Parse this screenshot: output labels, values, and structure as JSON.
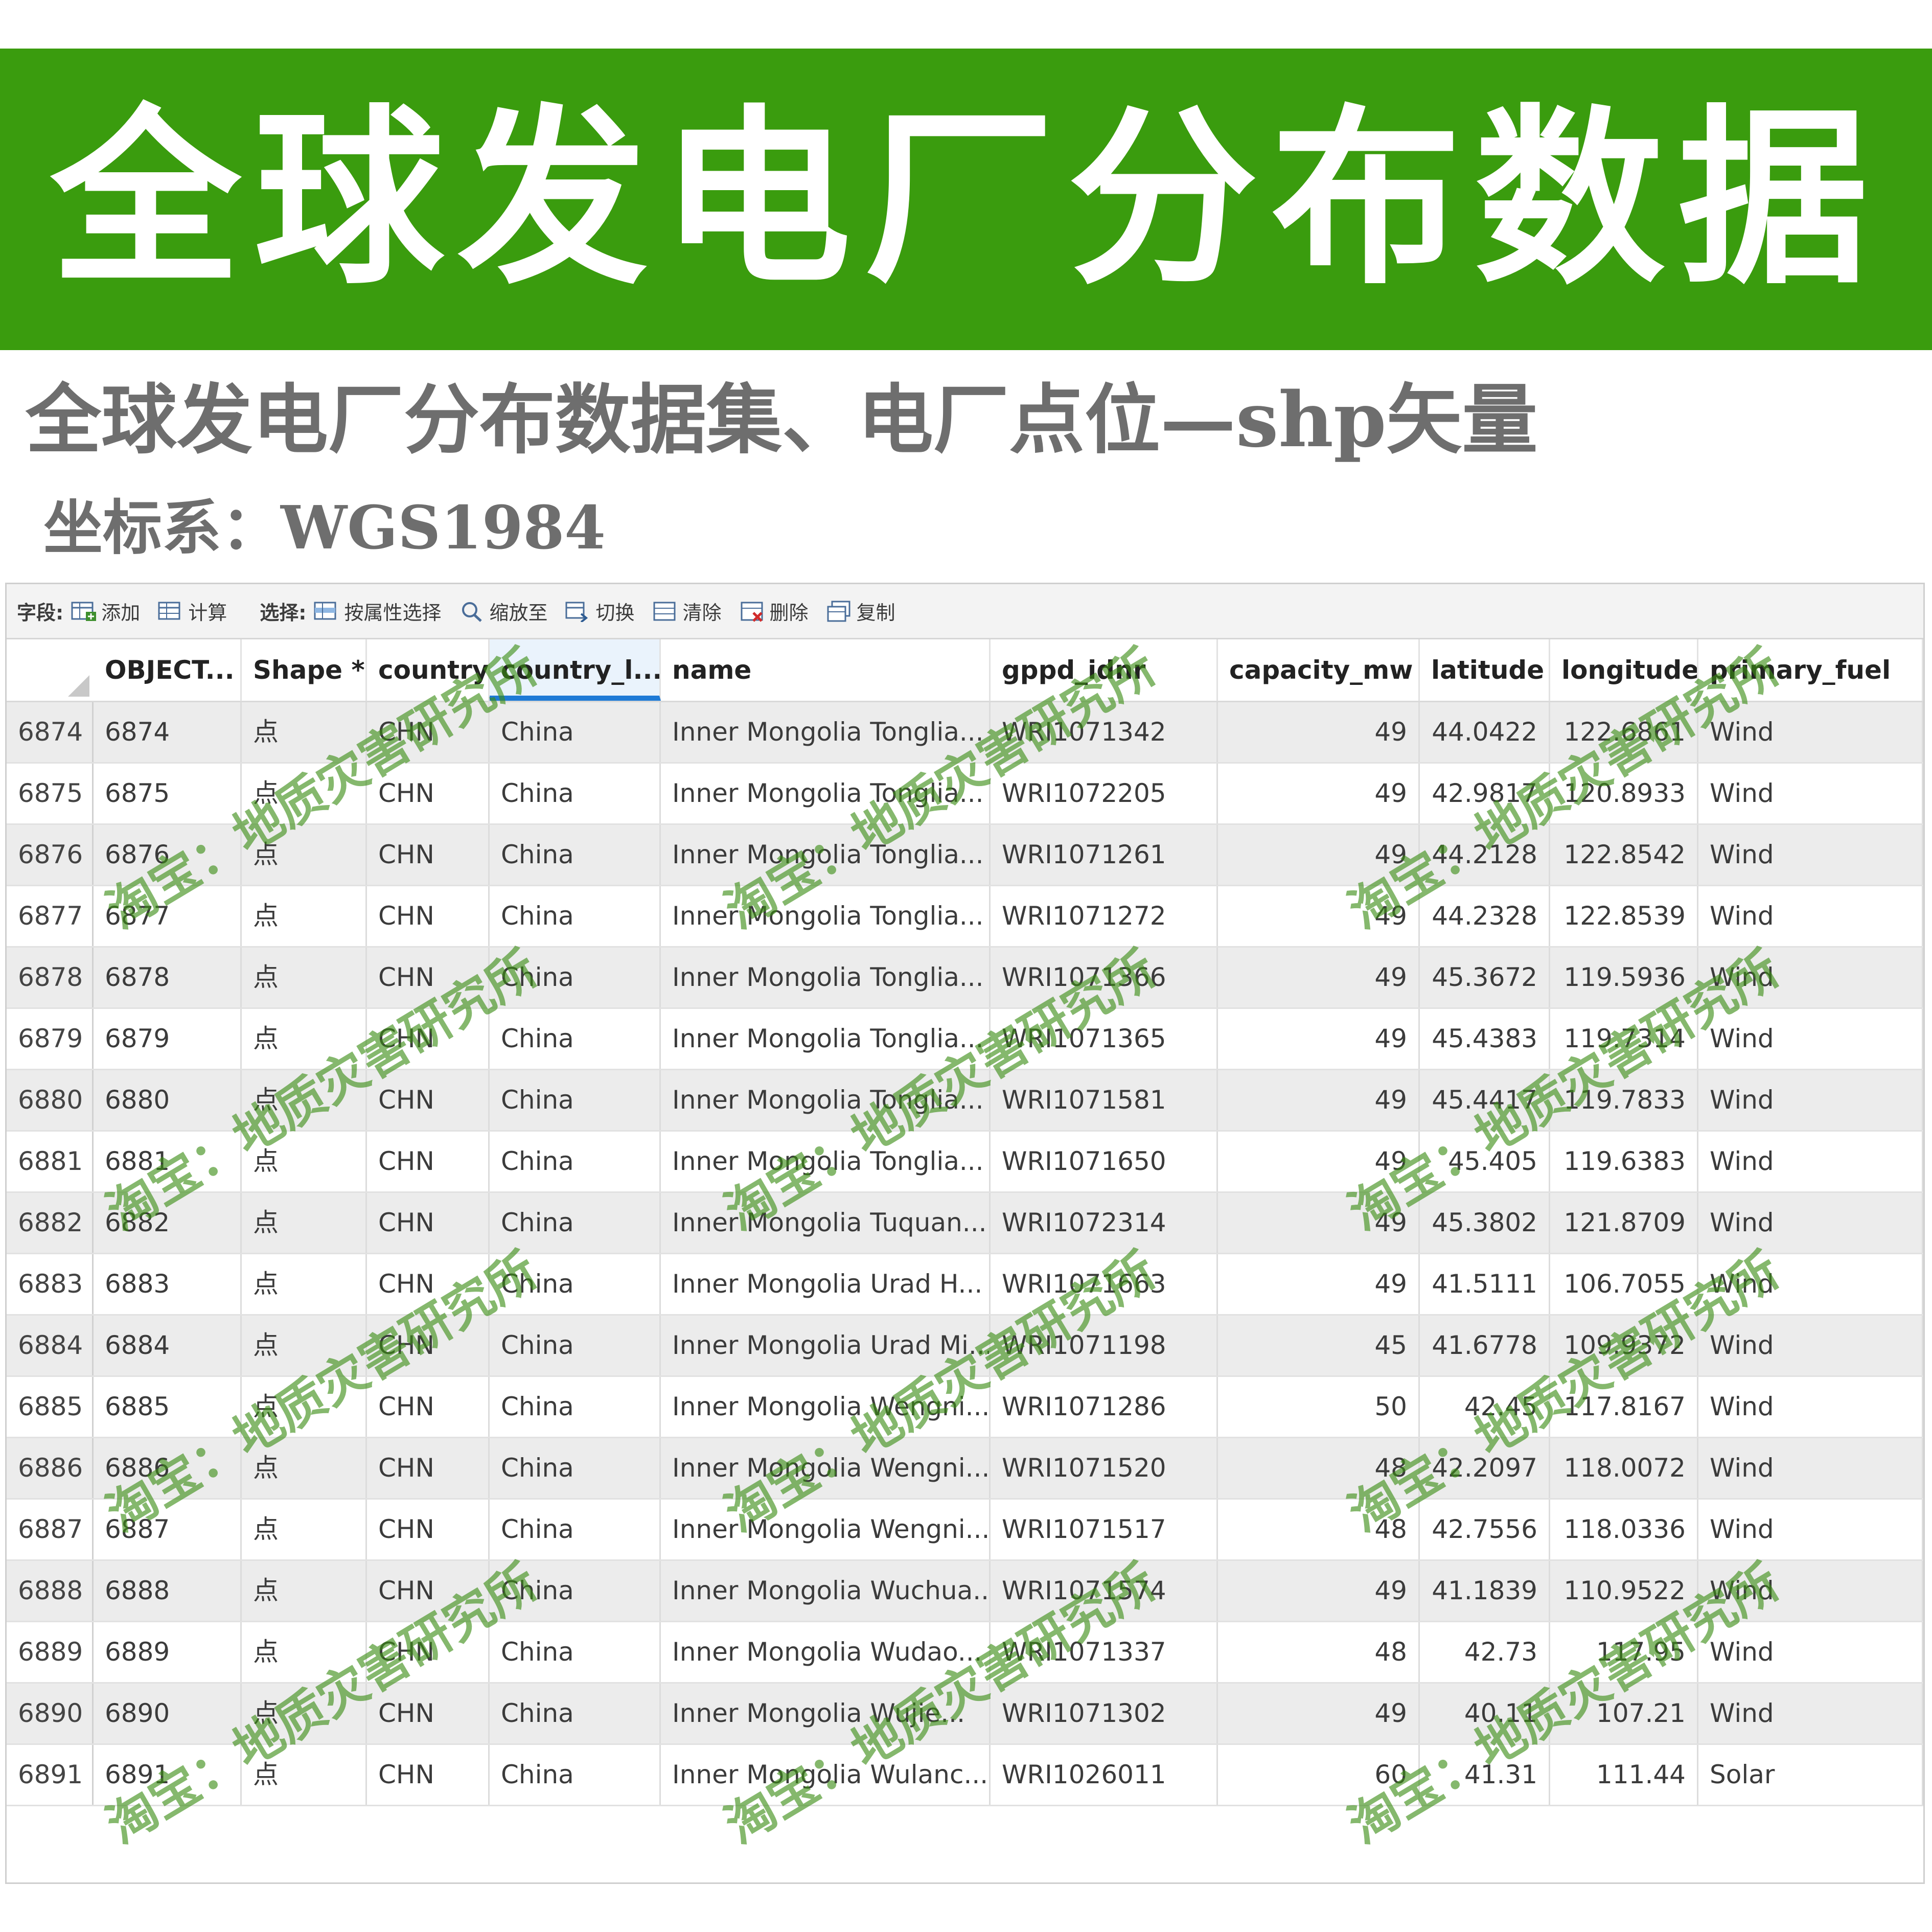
{
  "banner": {
    "title": "全球发电厂分布数据"
  },
  "subtitle": "全球发电厂分布数据集、电厂点位—shp矢量",
  "crs_line": "坐标系：WGS1984",
  "toolbar": {
    "field_label": "字段:",
    "add": "添加",
    "calculate": "计算",
    "select_label": "选择:",
    "select_by_attr": "按属性选择",
    "zoom_to": "缩放至",
    "switch": "切换",
    "clear": "清除",
    "delete": "删除",
    "copy": "复制"
  },
  "table": {
    "columns": [
      "OBJECT...",
      "Shape *",
      "country",
      "country_l...",
      "name",
      "gppd_idnr",
      "capacity_mw",
      "latitude",
      "longitude",
      "primary_fuel"
    ],
    "rows": [
      {
        "rowhdr": "6874",
        "objectid": "6874",
        "shape": "点",
        "country": "CHN",
        "country_long": "China",
        "name": "Inner Mongolia Tonglia...",
        "gppd_idnr": "WRI1071342",
        "capacity_mw": "49",
        "latitude": "44.0422",
        "longitude": "122.6861",
        "primary_fuel": "Wind"
      },
      {
        "rowhdr": "6875",
        "objectid": "6875",
        "shape": "点",
        "country": "CHN",
        "country_long": "China",
        "name": "Inner Mongolia Tonglia...",
        "gppd_idnr": "WRI1072205",
        "capacity_mw": "49",
        "latitude": "42.9817",
        "longitude": "120.8933",
        "primary_fuel": "Wind"
      },
      {
        "rowhdr": "6876",
        "objectid": "6876",
        "shape": "点",
        "country": "CHN",
        "country_long": "China",
        "name": "Inner Mongolia Tonglia...",
        "gppd_idnr": "WRI1071261",
        "capacity_mw": "49",
        "latitude": "44.2128",
        "longitude": "122.8542",
        "primary_fuel": "Wind"
      },
      {
        "rowhdr": "6877",
        "objectid": "6877",
        "shape": "点",
        "country": "CHN",
        "country_long": "China",
        "name": "Inner Mongolia Tonglia...",
        "gppd_idnr": "WRI1071272",
        "capacity_mw": "49",
        "latitude": "44.2328",
        "longitude": "122.8539",
        "primary_fuel": "Wind"
      },
      {
        "rowhdr": "6878",
        "objectid": "6878",
        "shape": "点",
        "country": "CHN",
        "country_long": "China",
        "name": "Inner Mongolia Tonglia...",
        "gppd_idnr": "WRI1071366",
        "capacity_mw": "49",
        "latitude": "45.3672",
        "longitude": "119.5936",
        "primary_fuel": "Wind"
      },
      {
        "rowhdr": "6879",
        "objectid": "6879",
        "shape": "点",
        "country": "CHN",
        "country_long": "China",
        "name": "Inner Mongolia Tonglia...",
        "gppd_idnr": "WRI1071365",
        "capacity_mw": "49",
        "latitude": "45.4383",
        "longitude": "119.7314",
        "primary_fuel": "Wind"
      },
      {
        "rowhdr": "6880",
        "objectid": "6880",
        "shape": "点",
        "country": "CHN",
        "country_long": "China",
        "name": "Inner Mongolia Tonglia...",
        "gppd_idnr": "WRI1071581",
        "capacity_mw": "49",
        "latitude": "45.4417",
        "longitude": "119.7833",
        "primary_fuel": "Wind"
      },
      {
        "rowhdr": "6881",
        "objectid": "6881",
        "shape": "点",
        "country": "CHN",
        "country_long": "China",
        "name": "Inner Mongolia Tonglia...",
        "gppd_idnr": "WRI1071650",
        "capacity_mw": "49",
        "latitude": "45.405",
        "longitude": "119.6383",
        "primary_fuel": "Wind"
      },
      {
        "rowhdr": "6882",
        "objectid": "6882",
        "shape": "点",
        "country": "CHN",
        "country_long": "China",
        "name": "Inner Mongolia Tuquan...",
        "gppd_idnr": "WRI1072314",
        "capacity_mw": "49",
        "latitude": "45.3802",
        "longitude": "121.8709",
        "primary_fuel": "Wind"
      },
      {
        "rowhdr": "6883",
        "objectid": "6883",
        "shape": "点",
        "country": "CHN",
        "country_long": "China",
        "name": "Inner Mongolia Urad H...",
        "gppd_idnr": "WRI1071663",
        "capacity_mw": "49",
        "latitude": "41.5111",
        "longitude": "106.7055",
        "primary_fuel": "Wind"
      },
      {
        "rowhdr": "6884",
        "objectid": "6884",
        "shape": "点",
        "country": "CHN",
        "country_long": "China",
        "name": "Inner Mongolia Urad Mi...",
        "gppd_idnr": "WRI1071198",
        "capacity_mw": "45",
        "latitude": "41.6778",
        "longitude": "109.9372",
        "primary_fuel": "Wind"
      },
      {
        "rowhdr": "6885",
        "objectid": "6885",
        "shape": "点",
        "country": "CHN",
        "country_long": "China",
        "name": "Inner Mongolia Wengni...",
        "gppd_idnr": "WRI1071286",
        "capacity_mw": "50",
        "latitude": "42.45",
        "longitude": "117.8167",
        "primary_fuel": "Wind"
      },
      {
        "rowhdr": "6886",
        "objectid": "6886",
        "shape": "点",
        "country": "CHN",
        "country_long": "China",
        "name": "Inner Mongolia Wengni...",
        "gppd_idnr": "WRI1071520",
        "capacity_mw": "48",
        "latitude": "42.2097",
        "longitude": "118.0072",
        "primary_fuel": "Wind"
      },
      {
        "rowhdr": "6887",
        "objectid": "6887",
        "shape": "点",
        "country": "CHN",
        "country_long": "China",
        "name": "Inner Mongolia Wengni...",
        "gppd_idnr": "WRI1071517",
        "capacity_mw": "48",
        "latitude": "42.7556",
        "longitude": "118.0336",
        "primary_fuel": "Wind"
      },
      {
        "rowhdr": "6888",
        "objectid": "6888",
        "shape": "点",
        "country": "CHN",
        "country_long": "China",
        "name": "Inner Mongolia Wuchua...",
        "gppd_idnr": "WRI1071574",
        "capacity_mw": "49",
        "latitude": "41.1839",
        "longitude": "110.9522",
        "primary_fuel": "Wind"
      },
      {
        "rowhdr": "6889",
        "objectid": "6889",
        "shape": "点",
        "country": "CHN",
        "country_long": "China",
        "name": "Inner Mongolia Wudao...",
        "gppd_idnr": "WRI1071337",
        "capacity_mw": "48",
        "latitude": "42.73",
        "longitude": "117.95",
        "primary_fuel": "Wind"
      },
      {
        "rowhdr": "6890",
        "objectid": "6890",
        "shape": "点",
        "country": "CHN",
        "country_long": "China",
        "name": "Inner Mongolia Wujie...",
        "gppd_idnr": "WRI1071302",
        "capacity_mw": "49",
        "latitude": "40.11",
        "longitude": "107.21",
        "primary_fuel": "Wind"
      },
      {
        "rowhdr": "6891",
        "objectid": "6891",
        "shape": "点",
        "country": "CHN",
        "country_long": "China",
        "name": "Inner Mongolia Wulanc...",
        "gppd_idnr": "WRI1026011",
        "capacity_mw": "60",
        "latitude": "41.31",
        "longitude": "111.44",
        "primary_fuel": "Solar"
      }
    ]
  },
  "watermark": "淘宝：地质灾害研究所",
  "colors": {
    "banner_green": "#3a9c0e",
    "selected_header_underline": "#1e7ad6",
    "watermark_green": "#3a8c14"
  },
  "icons": [
    "add-field-icon",
    "calculate-field-icon",
    "select-by-attributes-icon",
    "zoom-to-icon",
    "switch-selection-icon",
    "clear-selection-icon",
    "delete-selection-icon",
    "copy-selection-icon",
    "scroll-left-icon"
  ]
}
